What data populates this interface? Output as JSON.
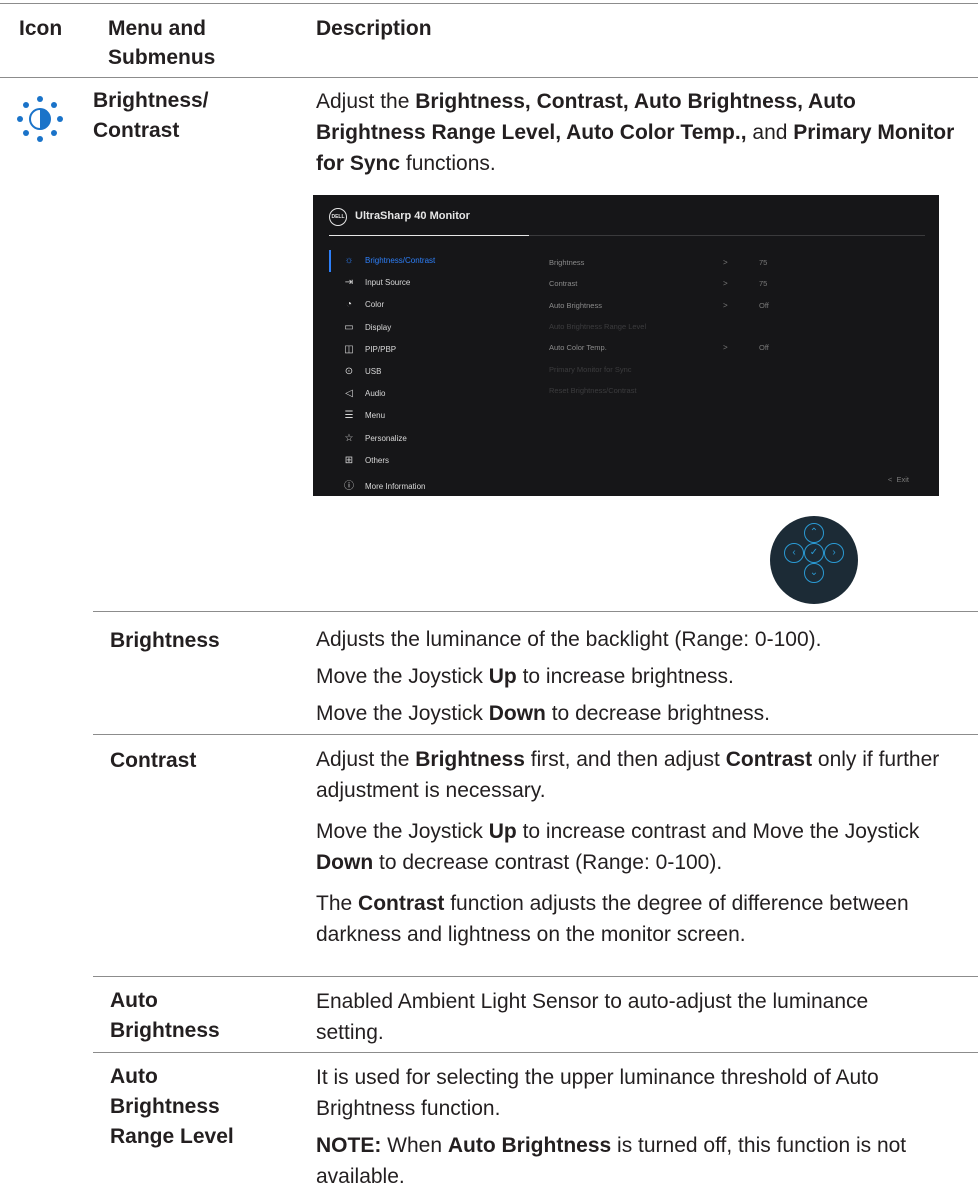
{
  "header": {
    "icon": "Icon",
    "menu": "Menu and Submenus",
    "menu_line1": "Menu and",
    "menu_line2": "Submenus",
    "description": "Description"
  },
  "section": {
    "icon": "brightness-contrast-icon",
    "title_line1": "Brightness/",
    "title_line2": "Contrast",
    "intro": {
      "t1": "Adjust the ",
      "b1": "Brightness, Contrast, Auto Brightness, Auto Brightness Range Level, Auto Color Temp.,",
      "t2": " and ",
      "b2": "Primary Monitor for Sync",
      "t3": " functions."
    }
  },
  "osd": {
    "logo": "DELL",
    "title": "UltraSharp 40 Monitor",
    "menu": [
      {
        "label": "Brightness/Contrast",
        "icon": "sun-icon",
        "active": true
      },
      {
        "label": "Input Source",
        "icon": "input-source-icon"
      },
      {
        "label": "Color",
        "icon": "palette-icon"
      },
      {
        "label": "Display",
        "icon": "monitor-icon"
      },
      {
        "label": "PIP/PBP",
        "icon": "pip-icon"
      },
      {
        "label": "USB",
        "icon": "mouse-icon"
      },
      {
        "label": "Audio",
        "icon": "speaker-icon"
      },
      {
        "label": "Menu",
        "icon": "menu-icon"
      },
      {
        "label": "Personalize",
        "icon": "star-icon"
      },
      {
        "label": "Others",
        "icon": "others-icon"
      },
      {
        "label": "More Information",
        "icon": "info-icon"
      }
    ],
    "submenu": [
      {
        "label": "Brightness",
        "arrow": ">",
        "value": "75"
      },
      {
        "label": "Contrast",
        "arrow": ">",
        "value": "75"
      },
      {
        "label": "Auto Brightness",
        "arrow": ">",
        "value": "Off"
      },
      {
        "label": "Auto Brightness Range Level",
        "arrow": "",
        "value": ""
      },
      {
        "label": "Auto Color Temp.",
        "arrow": ">",
        "value": "Off"
      },
      {
        "label": "Primary Monitor for Sync",
        "arrow": "",
        "value": ""
      },
      {
        "label": "Reset Brightness/Contrast",
        "arrow": "",
        "value": ""
      }
    ],
    "exit": "Exit",
    "exit_arrow": "<"
  },
  "joystick": {
    "up": "up-chevron-icon",
    "down": "down-chevron-icon",
    "left": "left-chevron-icon",
    "right": "right-chevron-icon",
    "center": "check-icon"
  },
  "rows": {
    "brightness": {
      "label": "Brightness",
      "p1": "Adjusts the luminance of the backlight (Range: 0-100).",
      "p2a": "Move the Joystick ",
      "p2b": "Up",
      "p2c": " to increase brightness.",
      "p3a": "Move the Joystick ",
      "p3b": "Down",
      "p3c": " to decrease brightness."
    },
    "contrast": {
      "label": "Contrast",
      "p1a": "Adjust the ",
      "p1b": "Brightness",
      "p1c": " first, and then adjust ",
      "p1d": "Contrast",
      "p1e": " only if further adjustment is necessary.",
      "p2a": "Move the Joystick ",
      "p2b": "Up",
      "p2c": " to increase contrast and Move the Joystick ",
      "p2d": "Down",
      "p2e": " to decrease contrast (Range: 0-100).",
      "p3a": "The ",
      "p3b": "Contrast",
      "p3c": " function adjusts the degree of difference between darkness and lightness on the monitor screen."
    },
    "auto_brightness": {
      "label_line1": "Auto",
      "label_line2": "Brightness",
      "p1": "Enabled Ambient Light Sensor to auto-adjust the luminance setting."
    },
    "auto_range": {
      "label_line1": "Auto",
      "label_line2": "Brightness",
      "label_line3": "Range Level",
      "p1": "It is used for selecting the upper luminance threshold of Auto Brightness function.",
      "note_a": "NOTE:",
      "note_b": " When ",
      "note_c": "Auto Brightness",
      "note_d": " is turned off, this function is not available."
    }
  }
}
